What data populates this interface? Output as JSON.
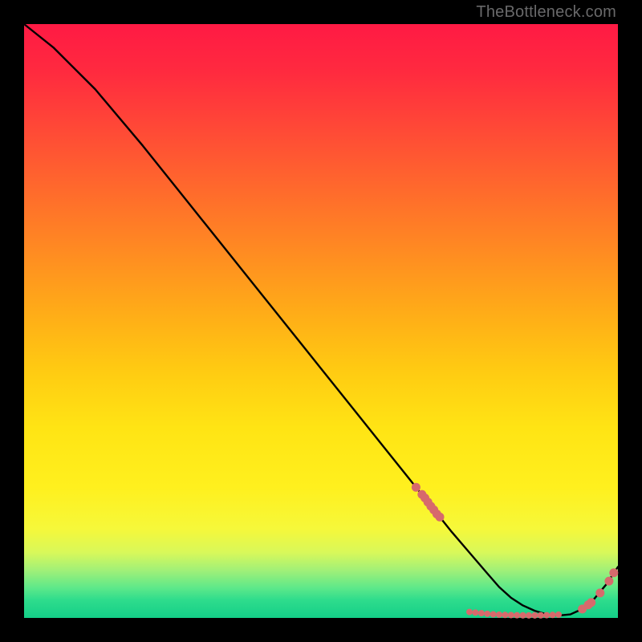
{
  "watermark": "TheBottleneck.com",
  "colors": {
    "background": "#000000",
    "curve_stroke": "#000000",
    "marker_fill": "#d76a6c",
    "marker_stroke": "#d76a6c"
  },
  "chart_data": {
    "type": "line",
    "title": "",
    "xlabel": "",
    "ylabel": "",
    "xlim": [
      0,
      100
    ],
    "ylim": [
      0,
      100
    ],
    "grid": false,
    "x": [
      0,
      5,
      8,
      12,
      20,
      30,
      40,
      50,
      60,
      66,
      72,
      75,
      78,
      80,
      82,
      84,
      86,
      88,
      90,
      92,
      94,
      96,
      98,
      100
    ],
    "values": [
      100,
      96,
      93,
      89,
      79.5,
      67,
      54.5,
      42,
      29.5,
      22,
      14.5,
      11,
      7.5,
      5.2,
      3.4,
      2.1,
      1.2,
      0.6,
      0.4,
      0.6,
      1.5,
      3.2,
      5.6,
      8.6
    ],
    "markers": {
      "descent_cluster_x": [
        66,
        67,
        67.5,
        68,
        68.5,
        69,
        69.5,
        70
      ],
      "descent_cluster_y": [
        22,
        20.8,
        20.2,
        19.5,
        18.8,
        18.2,
        17.5,
        17
      ],
      "valley_cluster_x": [
        75,
        76,
        77,
        78,
        79,
        80,
        81,
        82,
        83,
        84,
        85,
        86,
        87,
        88,
        89,
        90
      ],
      "valley_cluster_y": [
        1.0,
        0.9,
        0.8,
        0.7,
        0.6,
        0.55,
        0.5,
        0.48,
        0.45,
        0.44,
        0.43,
        0.43,
        0.44,
        0.46,
        0.5,
        0.55
      ],
      "ascent_cluster_x": [
        94,
        95,
        95.5,
        97,
        98.5,
        99.3
      ],
      "ascent_cluster_y": [
        1.5,
        2.2,
        2.6,
        4.2,
        6.2,
        7.6
      ]
    }
  }
}
